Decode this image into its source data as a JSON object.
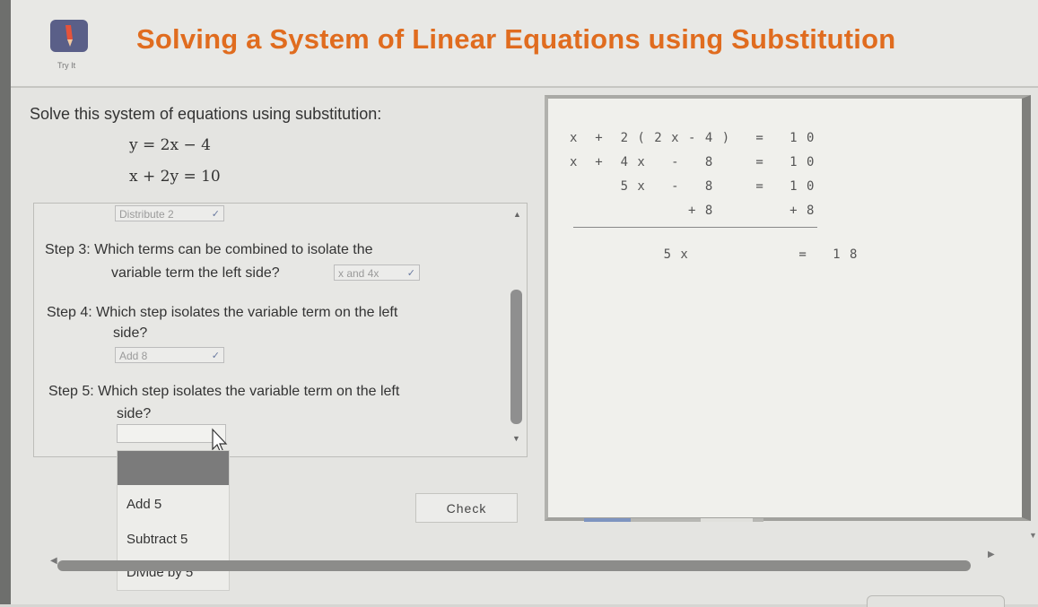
{
  "header": {
    "logo_caption": "Try It",
    "title": "Solving a System of Linear Equations using Substitution"
  },
  "problem": {
    "instruction": "Solve this system of equations using substitution:",
    "equation1": "y = 2x − 4",
    "equation2": "x + 2y = 10"
  },
  "steps": {
    "prev_select_value": "Distribute 2",
    "step3_line1": "Step 3: Which terms can be combined to isolate the",
    "step3_line2": "variable term the left side?",
    "step3_select_value": "x and 4x",
    "step4_line1": "Step 4: Which step isolates the variable term on the left",
    "step4_line2": "side?",
    "step4_select_value": "Add 8",
    "step5_line1": "Step 5: Which step isolates the variable term on the left",
    "step5_line2": "side?",
    "step5_select_value": ""
  },
  "dropdown": {
    "options": [
      "Add 5",
      "Subtract 5",
      "Divide by 5"
    ]
  },
  "check_label": "Check",
  "work": {
    "row1": "x  +  2 ( 2 x - 4 )   =   1 0",
    "row2": "x  +  4 x   -   8     =   1 0",
    "row3": "      5 x   -   8     =   1 0",
    "row4": "              + 8         + 8",
    "row5": "      5 x             =   1 8"
  },
  "icons": {
    "logo": "pencil-icon",
    "chevron": "chevron-down-icon"
  },
  "colors": {
    "title": "#e06c1f",
    "logo_bg": "#5a5f88"
  }
}
